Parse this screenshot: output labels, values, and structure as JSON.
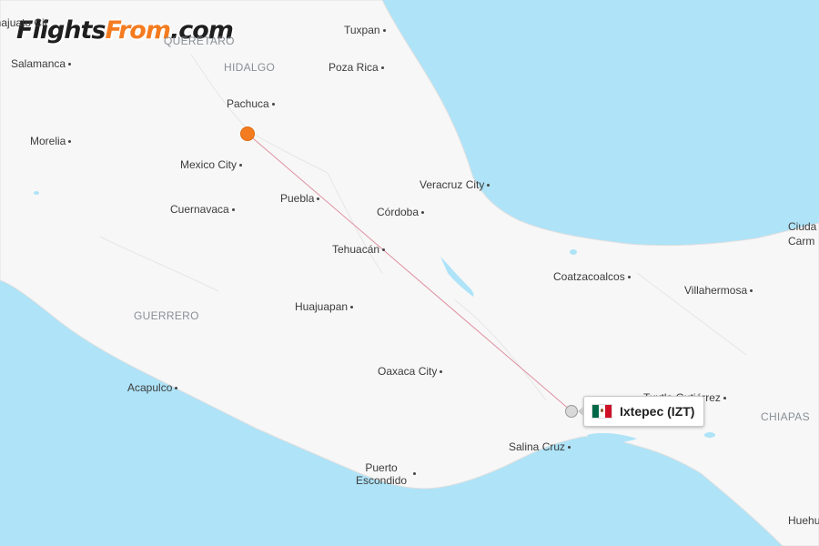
{
  "logo": {
    "part1": "Flights",
    "part2": "From",
    "part3": ".com"
  },
  "cities": [
    {
      "id": "salamanca",
      "label": "Salamanca"
    },
    {
      "id": "morelia",
      "label": "Morelia"
    },
    {
      "id": "pachuca",
      "label": "Pachuca"
    },
    {
      "id": "mexico-city",
      "label": "Mexico City"
    },
    {
      "id": "puebla",
      "label": "Puebla"
    },
    {
      "id": "cuernavaca",
      "label": "Cuernavaca"
    },
    {
      "id": "tuxpan",
      "label": "Tuxpan"
    },
    {
      "id": "poza-rica",
      "label": "Poza Rica"
    },
    {
      "id": "veracruz-city",
      "label": "Veracruz City"
    },
    {
      "id": "cordoba",
      "label": "Córdoba"
    },
    {
      "id": "tehuacan",
      "label": "Tehuacán"
    },
    {
      "id": "huajuapan",
      "label": "Huajuapan"
    },
    {
      "id": "oaxaca-city",
      "label": "Oaxaca City"
    },
    {
      "id": "acapulco",
      "label": "Acapulco"
    },
    {
      "id": "puerto-escondido",
      "label": "Puerto\nEscondido"
    },
    {
      "id": "salina-cruz",
      "label": "Salina Cruz"
    },
    {
      "id": "coatzacoalcos",
      "label": "Coatzacoalcos"
    },
    {
      "id": "villahermosa",
      "label": "Villahermosa"
    },
    {
      "id": "tuxtla-gutierrez",
      "label": "Tuxtla Gutiérrez"
    },
    {
      "id": "ciudad-carmen",
      "label": "Ciuda\nCarm"
    },
    {
      "id": "huehuetenango",
      "label": "Huehu"
    },
    {
      "id": "guanajuato-cut",
      "label": "anajuato Cit"
    }
  ],
  "regions": [
    {
      "id": "hidalgo",
      "label": "HIDALGO"
    },
    {
      "id": "queretaro",
      "label": "QUERÉTARO"
    },
    {
      "id": "guerrero",
      "label": "GUERRERO"
    },
    {
      "id": "chiapas",
      "label": "CHIAPAS"
    }
  ],
  "tooltip": {
    "label": "Ixtepec (IZT)"
  },
  "colors": {
    "ocean": "#aee3f8",
    "land": "#f7f7f7",
    "route": "#e08fa0",
    "origin": "#f47c20",
    "destination": "#d9d9d9"
  },
  "icons": {
    "origin": "origin-marker-icon",
    "destination": "destination-marker-icon",
    "flag": "mexico-flag-icon"
  }
}
